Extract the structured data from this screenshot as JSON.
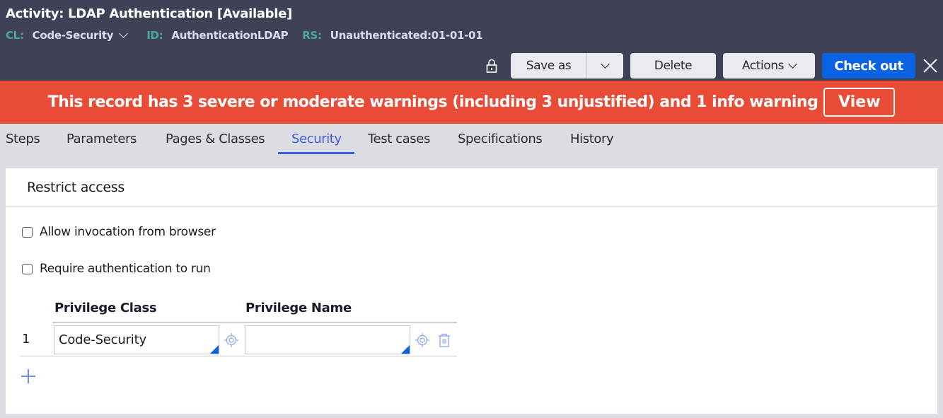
{
  "header": {
    "title": "Activity: LDAP Authentication [Available]",
    "meta": [
      {
        "key": "CL:",
        "value": "Code-Security",
        "has_dropdown": true
      },
      {
        "key": "ID:",
        "value": "AuthenticationLDAP"
      },
      {
        "key": "RS:",
        "value": "Unauthenticated:01-01-01"
      }
    ],
    "toolbar": {
      "lock_icon": "lock-icon",
      "save_as_label": "Save as",
      "delete_label": "Delete",
      "actions_label": "Actions",
      "check_out_label": "Check out",
      "close_icon": "close-icon"
    },
    "colors": {
      "header_bg": "#3f4156",
      "meta_key": "#4aa8a6",
      "primary": "#0a63e3",
      "banner": "#e84b36",
      "active_tab": "#3f5cdb"
    }
  },
  "banner": {
    "message": "This record has 3 severe or moderate warnings (including 3 unjustified) and 1 info warning",
    "view_label": "View"
  },
  "tabs": [
    {
      "label": "Steps",
      "active": false
    },
    {
      "label": "Parameters",
      "active": false
    },
    {
      "label": "Pages & Classes",
      "active": false
    },
    {
      "label": "Security",
      "active": true
    },
    {
      "label": "Test cases",
      "active": false
    },
    {
      "label": "Specifications",
      "active": false
    },
    {
      "label": "History",
      "active": false
    }
  ],
  "security": {
    "section_title": "Restrict access",
    "checkboxes": [
      {
        "label": "Allow invocation from browser",
        "checked": false
      },
      {
        "label": "Require authentication to run",
        "checked": false
      }
    ],
    "privileges": {
      "columns": [
        "Privilege Class",
        "Privilege Name"
      ],
      "rows": [
        {
          "index": "1",
          "privilege_class": "Code-Security",
          "privilege_name": ""
        }
      ],
      "add_icon": "plus-icon"
    }
  }
}
